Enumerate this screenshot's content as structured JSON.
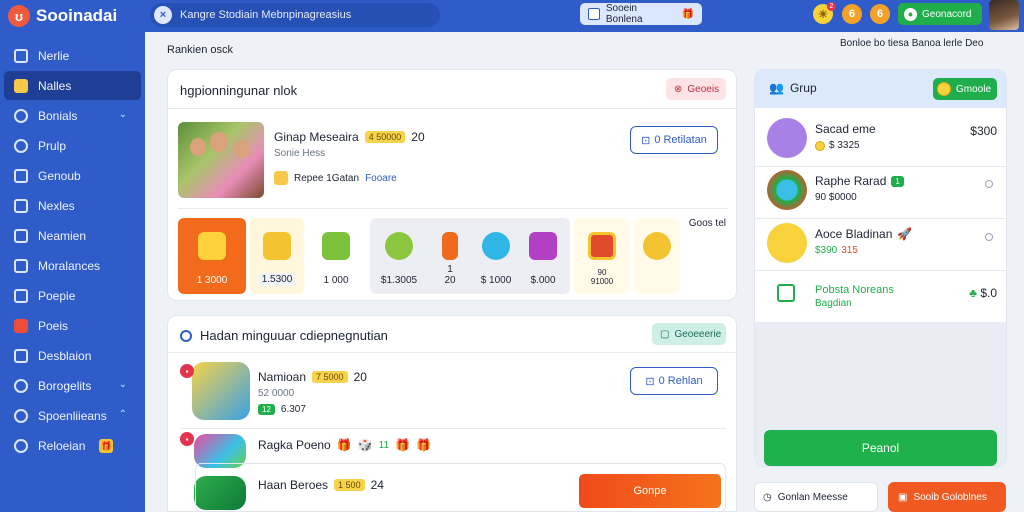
{
  "app": {
    "name": "Sooinadai",
    "logo_glyph": "ʊ"
  },
  "topbar": {
    "search_text": "Kangre Stodiain  Mebnpinagreasius",
    "promo_label": "Sooein Bonlena",
    "icon_badge": "2",
    "coin_icon_1": "6",
    "coin_icon_2": "6",
    "join_label": "Geonacord"
  },
  "sidebar": {
    "items": [
      {
        "label": "Nerlie",
        "icon": "grid-icon"
      },
      {
        "label": "Nalles",
        "icon": "image-icon",
        "active": true
      },
      {
        "label": "Bonials",
        "icon": "globe-icon",
        "chevron": true
      },
      {
        "label": "Prulp",
        "icon": "pin-icon"
      },
      {
        "label": "Genoub",
        "icon": "chat-icon"
      },
      {
        "label": "Nexles",
        "icon": "mail-icon"
      },
      {
        "label": "Neamien",
        "icon": "video-icon"
      },
      {
        "label": "Moralances",
        "icon": "grid-icon"
      },
      {
        "label": "Poepie",
        "icon": "chart-icon"
      },
      {
        "label": "Poeis",
        "icon": "play-icon"
      },
      {
        "label": "Desblaion",
        "icon": "send-icon"
      },
      {
        "label": "Borogelits",
        "icon": "gear-icon",
        "chevron": true
      },
      {
        "label": "Spoenliieans",
        "icon": "search-icon",
        "chevron": true
      },
      {
        "label": "Reloeian",
        "icon": "bell-icon",
        "badge": "🎁"
      }
    ]
  },
  "main": {
    "breadcrumb": "Rankien osck",
    "header_note": "Bonloe bo tiesa Banoa lerle Deo",
    "card1": {
      "title": "hgpionningunar nlok",
      "pill_label": "Geoeis",
      "group_name": "Ginap Meseaira",
      "group_tag": "4 50000",
      "group_count": "20",
      "group_sub": "Sonie Hess",
      "meta_text": "Repee 1Gatan",
      "meta_link": "Fooare",
      "button_label": "0 Retilatan",
      "tiles_note": "Goos tel",
      "tiles": [
        {
          "label": "1 3000",
          "color": "#f26a1b"
        },
        {
          "label": "1.5300",
          "color": "#fff6dc"
        },
        {
          "label": "1 000",
          "color": "#ffffff"
        },
        {
          "label": "$1.3005",
          "color": "#eceef3"
        },
        {
          "label": "1\n20",
          "color": "#eceef3"
        },
        {
          "label": "$ 1000",
          "color": "#eceef3"
        },
        {
          "label": "$.000",
          "color": "#eceef3"
        },
        {
          "label": "90\n91000",
          "color": "#fffbe8"
        },
        {
          "label": "",
          "color": "#fffbe8"
        }
      ]
    },
    "card2": {
      "title": "Hadan minguuar cdiepnegnutian",
      "pill_label": "Geoeeerie",
      "rows": [
        {
          "title": "Namioan",
          "tag": "7 5000",
          "count": "20",
          "sub": "52 0000",
          "sub2": "6.307",
          "green_tag": "12"
        },
        {
          "title": "Ragka Poeno",
          "stickers": [
            "🎁",
            "🎲",
            "11",
            "🎁",
            "🎁"
          ]
        },
        {
          "title": "Haan Beroes",
          "tag": "1 500",
          "count": "24"
        }
      ],
      "row_button_1": "0 Rehlan",
      "row_button_3": "Gonpe"
    }
  },
  "right": {
    "title": "Grup",
    "pill_label": "Gmoole",
    "items": [
      {
        "name": "Sacad eme",
        "sub": "$ 3325",
        "price": "$300",
        "color": "#a880e6"
      },
      {
        "name": "Raphe Rarad",
        "sub": "90 $0000",
        "badge": "1"
      },
      {
        "name": "Aoce Bladinan",
        "sub": "$390",
        "sub2": "315"
      },
      {
        "name": "Pobsta Noreans",
        "sub": "Bagdian",
        "price": "$.0"
      }
    ],
    "primary_button": "Peanol",
    "footer_left": "Gonlan Meesse",
    "footer_right": "Sooib Goloblnes"
  }
}
